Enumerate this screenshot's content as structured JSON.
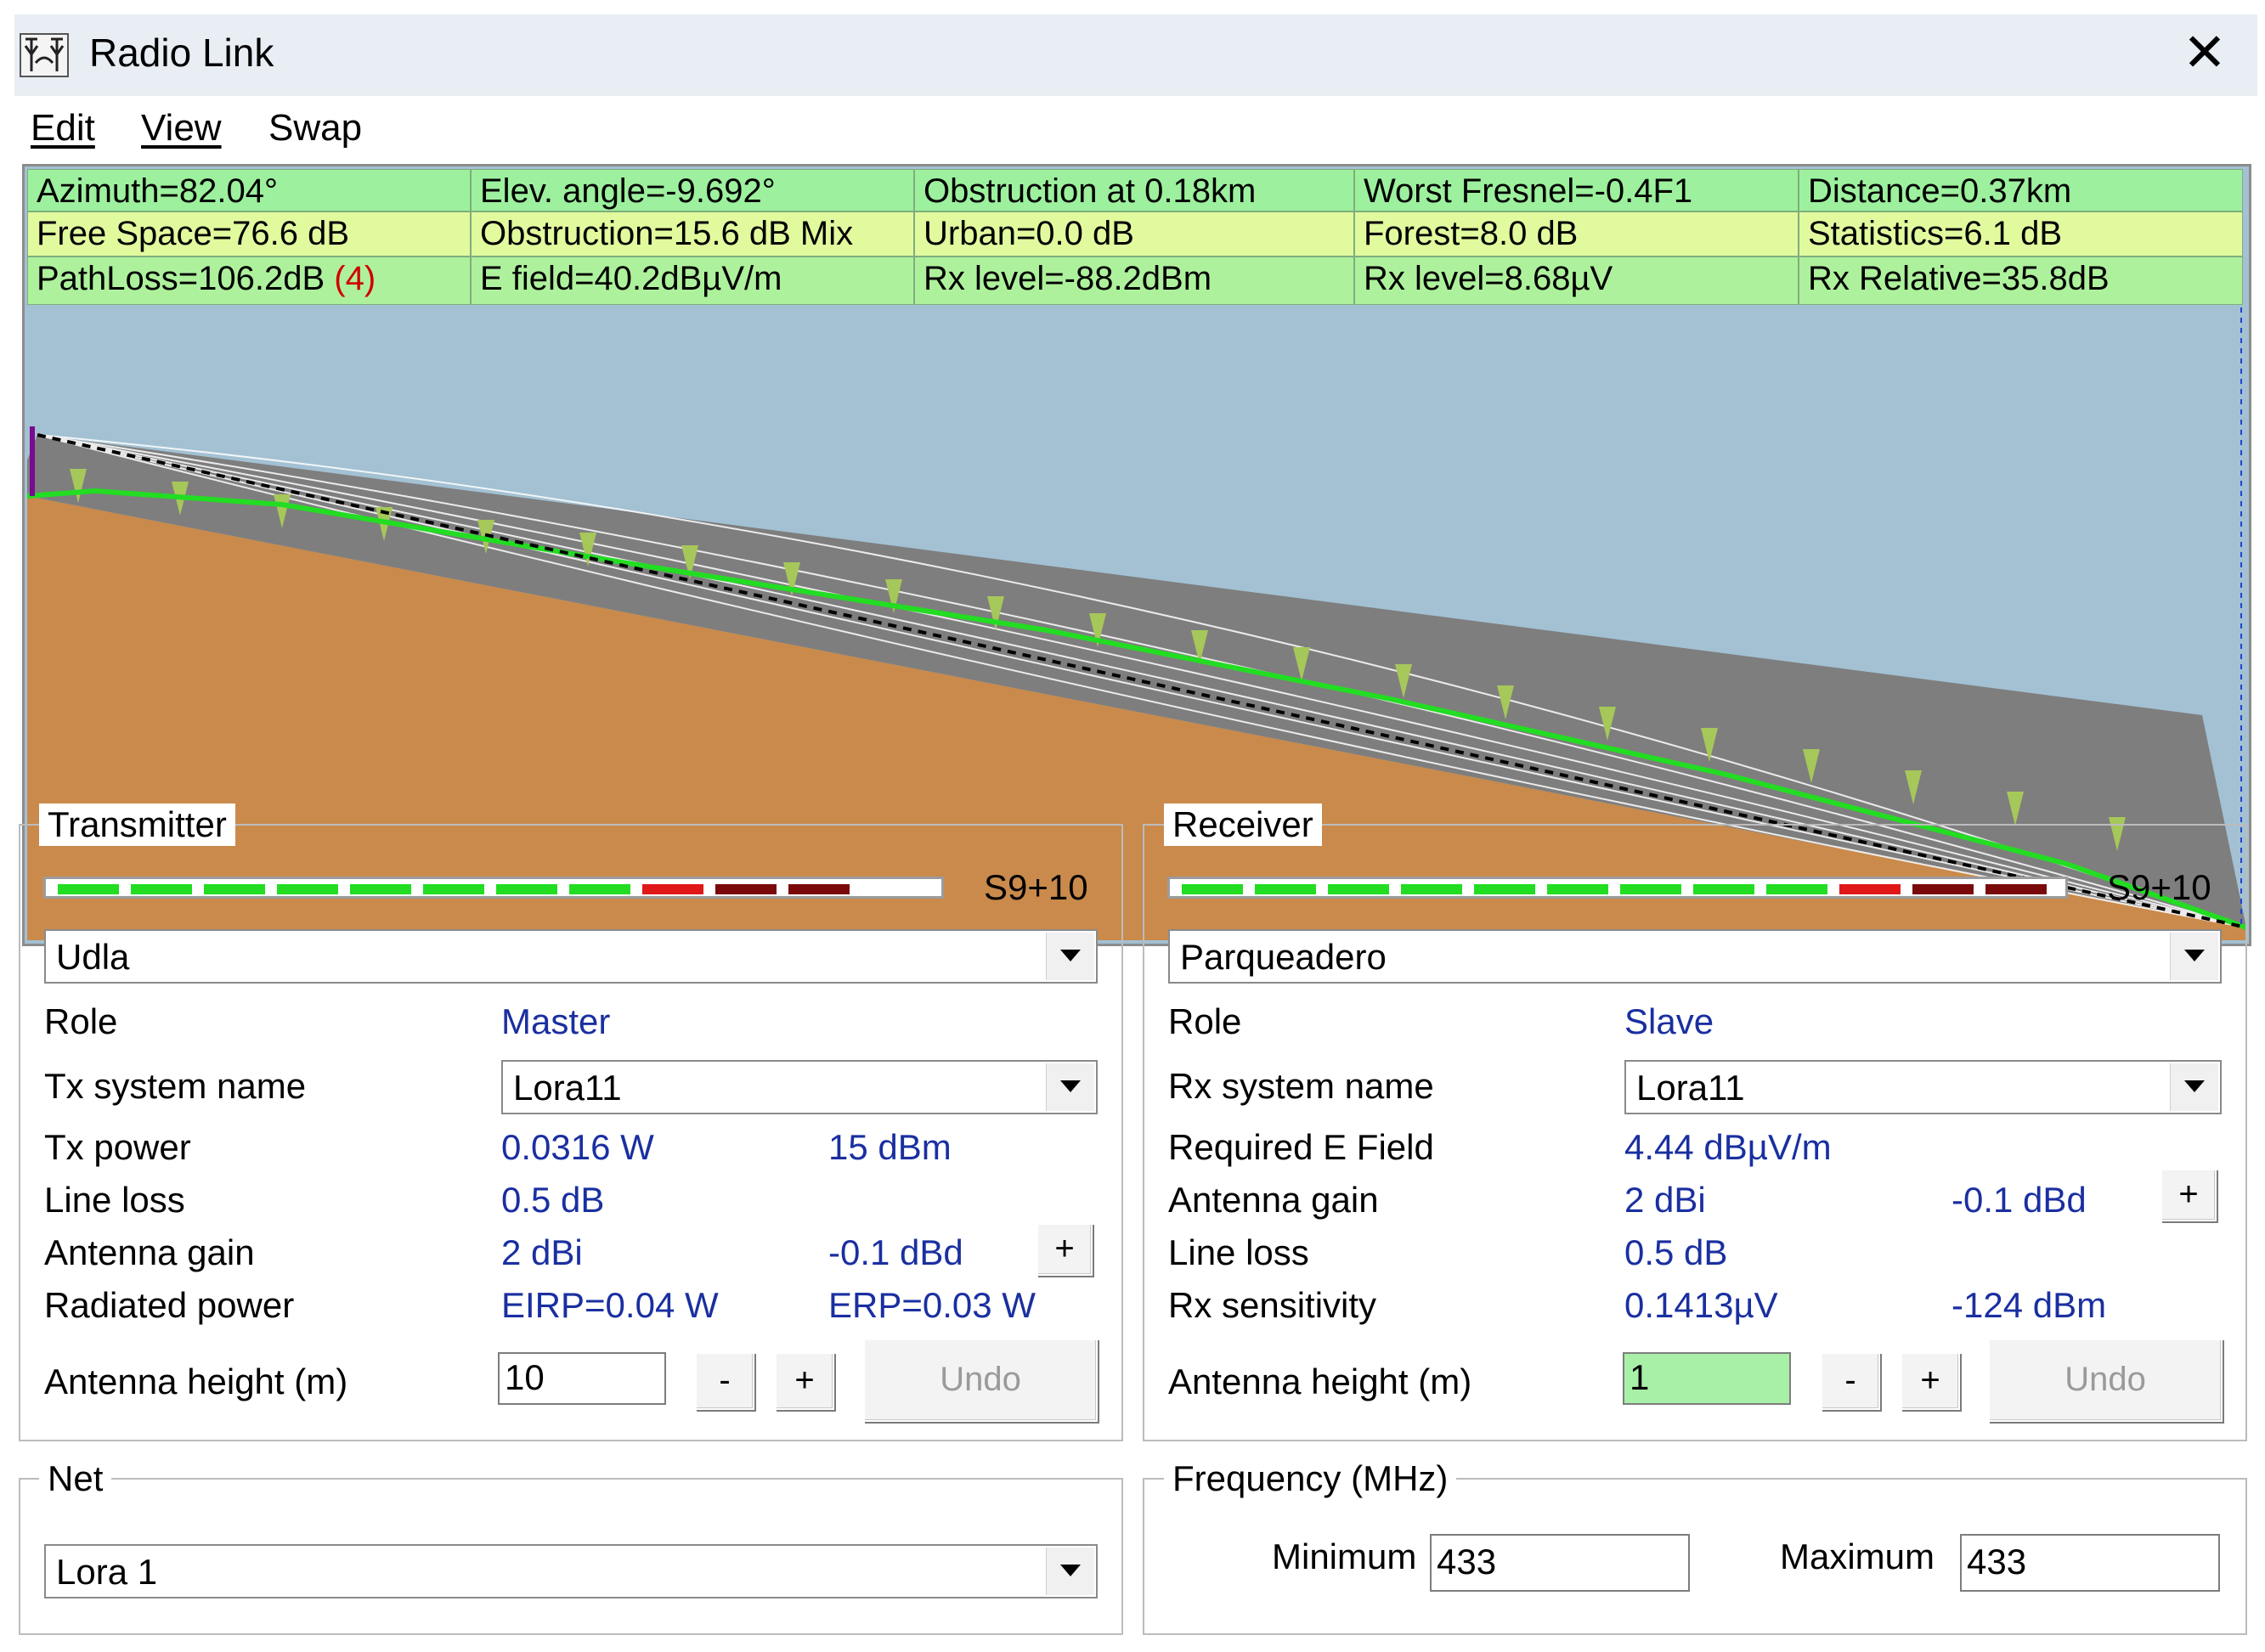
{
  "window": {
    "title": "Radio Link",
    "close": "✕"
  },
  "menu": [
    "Edit",
    "View",
    "Swap"
  ],
  "info": {
    "row1": [
      "Azimuth=82.04°",
      "Elev. angle=-9.692°",
      "Obstruction at 0.18km",
      "Worst Fresnel=-0.4F1",
      "Distance=0.37km"
    ],
    "row2": [
      "Free Space=76.6 dB",
      "Obstruction=15.6 dB Mix",
      "Urban=0.0 dB",
      "Forest=8.0 dB",
      "Statistics=6.1 dB"
    ],
    "row3": [
      "PathLoss=106.2dB",
      "E field=40.2dBµV/m",
      "Rx level=-88.2dBm",
      "Rx level=8.68µV",
      "Rx Relative=35.8dB"
    ],
    "pathloss_tag": "(4)"
  },
  "colors": {
    "sky": "#a3c1d3",
    "terrain": "#c98a4c",
    "fresnel": "#7e7e7e",
    "ground_line": "#22dd22",
    "meter_green": "#22dd22",
    "meter_red": "#e01818",
    "meter_darkred": "#7a0a0a"
  },
  "transmitter": {
    "title": "Transmitter",
    "smeter": "S9+10",
    "meter_level": {
      "green": 8,
      "red": 1,
      "darkred": 2
    },
    "site": "Udla",
    "role_label": "Role",
    "role": "Master",
    "system_label": "Tx system name",
    "system": "Lora11",
    "power_label": "Tx power",
    "power_w": "0.0316 W",
    "power_dbm": "15 dBm",
    "lineloss_label": "Line loss",
    "lineloss": "0.5 dB",
    "gain_label": "Antenna gain",
    "gain_dbi": "2 dBi",
    "gain_dbd": "-0.1 dBd",
    "radiated_label": "Radiated power",
    "eirp": "EIRP=0.04 W",
    "erp": "ERP=0.03 W",
    "height_label": "Antenna height (m)",
    "height": "10",
    "minus": "-",
    "plus": "+",
    "undo": "Undo"
  },
  "receiver": {
    "title": "Receiver",
    "smeter": "S9+10",
    "meter_level": {
      "green": 9,
      "red": 1,
      "darkred": 2
    },
    "site": "Parqueadero",
    "role_label": "Role",
    "role": "Slave",
    "system_label": "Rx system name",
    "system": "Lora11",
    "efield_label": "Required E Field",
    "efield": "4.44 dBµV/m",
    "gain_label": "Antenna gain",
    "gain_dbi": "2 dBi",
    "gain_dbd": "-0.1 dBd",
    "lineloss_label": "Line loss",
    "lineloss": "0.5 dB",
    "sens_label": "Rx sensitivity",
    "sens_uv": "0.1413µV",
    "sens_dbm": "-124 dBm",
    "height_label": "Antenna height (m)",
    "height": "1",
    "minus": "-",
    "plus": "+",
    "undo": "Undo"
  },
  "net": {
    "title": "Net",
    "value": "Lora 1"
  },
  "frequency": {
    "title": "Frequency (MHz)",
    "min_label": "Minimum",
    "min": "433",
    "max_label": "Maximum",
    "max": "433"
  }
}
